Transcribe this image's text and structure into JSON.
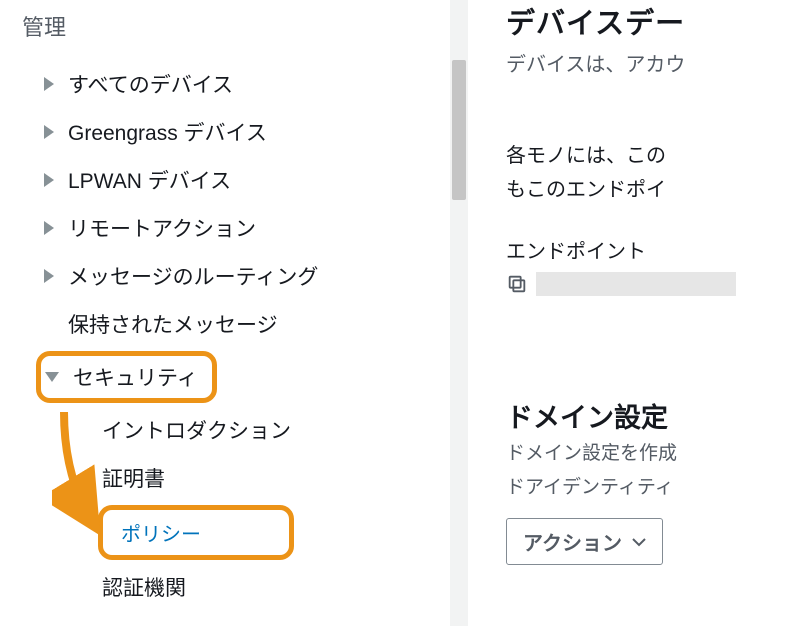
{
  "sidebar": {
    "heading": "管理",
    "items": [
      {
        "label": "すべてのデバイス",
        "expanded": false,
        "hasChildren": true
      },
      {
        "label": "Greengrass デバイス",
        "expanded": false,
        "hasChildren": true
      },
      {
        "label": "LPWAN デバイス",
        "expanded": false,
        "hasChildren": true
      },
      {
        "label": "リモートアクション",
        "expanded": false,
        "hasChildren": true
      },
      {
        "label": "メッセージのルーティング",
        "expanded": false,
        "hasChildren": true
      },
      {
        "label": "保持されたメッセージ",
        "expanded": false,
        "hasChildren": false
      },
      {
        "label": "セキュリティ",
        "expanded": true,
        "hasChildren": true,
        "highlighted": true,
        "children": [
          {
            "label": "イントロダクション"
          },
          {
            "label": "証明書"
          },
          {
            "label": "ポリシー",
            "active": true,
            "highlighted": true
          },
          {
            "label": "認証機関"
          }
        ]
      }
    ]
  },
  "main": {
    "title_partial": "デバイスデー",
    "subtitle_partial": "デバイスは、アカウ",
    "body_line1": "各モノには、この",
    "body_line2": "もこのエンドポイ",
    "endpoint_label": "エンドポイント",
    "domain_title": "ドメイン設定",
    "domain_desc_line1": "ドメイン設定を作成",
    "domain_desc_line2": "ドアイデンティティ",
    "action_label": "アクション"
  }
}
